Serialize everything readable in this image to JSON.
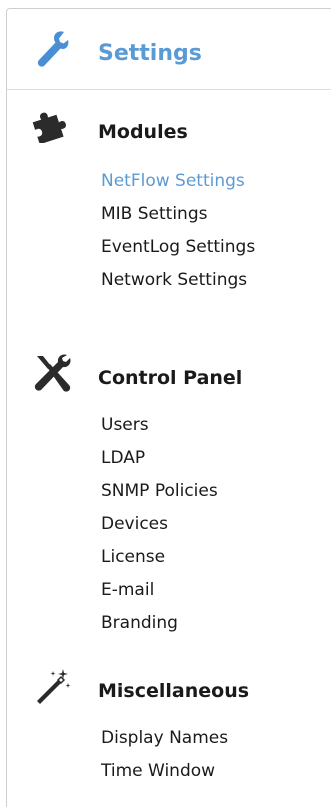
{
  "header": {
    "title": "Settings",
    "icon": "wrench-icon",
    "title_color": "#5b9bd5"
  },
  "sections": [
    {
      "title": "Modules",
      "icon": "puzzle-piece-icon",
      "items": [
        "NetFlow Settings",
        "MIB Settings",
        "EventLog Settings",
        "Network Settings"
      ],
      "active_item": "NetFlow Settings"
    },
    {
      "title": "Control Panel",
      "icon": "tools-icon",
      "items": [
        "Users",
        "LDAP",
        "SNMP Policies",
        "Devices",
        "License",
        "E-mail",
        "Branding"
      ]
    },
    {
      "title": "Miscellaneous",
      "icon": "magic-wand-icon",
      "items": [
        "Display Names",
        "Time Window"
      ]
    }
  ]
}
